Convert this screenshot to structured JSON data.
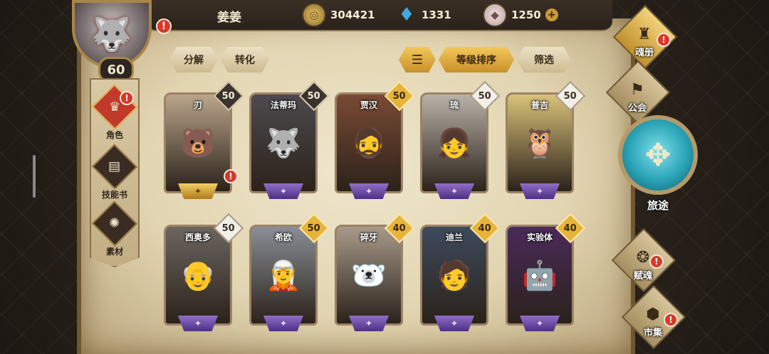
{
  "player": {
    "name": "姜姜",
    "level": "60",
    "avatar_icon": "wolf-icon"
  },
  "resources": [
    {
      "icon": "gold-coin-icon",
      "value": "304421"
    },
    {
      "icon": "crystal-icon",
      "value": "1331"
    },
    {
      "icon": "gem-icon",
      "value": "1250"
    }
  ],
  "toolbar": {
    "decompose": "分解",
    "convert": "转化",
    "sort_level": "等级排序",
    "filter": "筛选"
  },
  "leftnav": [
    {
      "label": "角色",
      "icon": "character-icon",
      "active": true,
      "alert": true
    },
    {
      "label": "技能书",
      "icon": "skill-book-icon",
      "active": false,
      "alert": false
    },
    {
      "label": "素材",
      "icon": "material-icon",
      "active": false,
      "alert": false
    }
  ],
  "cards": [
    {
      "name": "刃",
      "level": "50",
      "badge": "dark",
      "portrait": "🐻",
      "bg": "#b9a58a",
      "base": "gold",
      "alert": true
    },
    {
      "name": "法蒂玛",
      "level": "50",
      "badge": "dark",
      "portrait": "🐺",
      "bg": "#4d4a4e",
      "base": "purple",
      "alert": false
    },
    {
      "name": "贾汉",
      "level": "50",
      "badge": "gold",
      "portrait": "🧔",
      "bg": "#7a4a34",
      "base": "purple",
      "alert": false
    },
    {
      "name": "琉",
      "level": "50",
      "badge": "light",
      "portrait": "👧",
      "bg": "#b9b2a8",
      "base": "purple",
      "alert": false
    },
    {
      "name": "普吉",
      "level": "50",
      "badge": "light",
      "portrait": "🦉",
      "bg": "#d9c27a",
      "base": "purple",
      "alert": false
    },
    {
      "name": "西奥多",
      "level": "50",
      "badge": "light",
      "portrait": "👴",
      "bg": "#6c6560",
      "base": "purple",
      "alert": false
    },
    {
      "name": "希欧",
      "level": "50",
      "badge": "gold",
      "portrait": "🧝",
      "bg": "#8a8e96",
      "base": "purple",
      "alert": false
    },
    {
      "name": "碎牙",
      "level": "40",
      "badge": "gold",
      "portrait": "🐻‍❄️",
      "bg": "#a89a8a",
      "base": "purple",
      "alert": false
    },
    {
      "name": "迪兰",
      "level": "40",
      "badge": "gold",
      "portrait": "🧑",
      "bg": "#3e4a5c",
      "base": "purple",
      "alert": false
    },
    {
      "name": "实验体",
      "level": "40",
      "badge": "gold",
      "portrait": "🤖",
      "bg": "#4a2a5a",
      "base": "purple",
      "alert": false
    }
  ],
  "rightnav": {
    "soul_book": "魂册",
    "guild": "公会",
    "journey": "旅途",
    "fusion": "赋魂",
    "market": "市集"
  },
  "colors": {
    "alert": "#d8392a",
    "accent_gold": "#e7b43a",
    "purple_base": "#6a4aa8"
  }
}
